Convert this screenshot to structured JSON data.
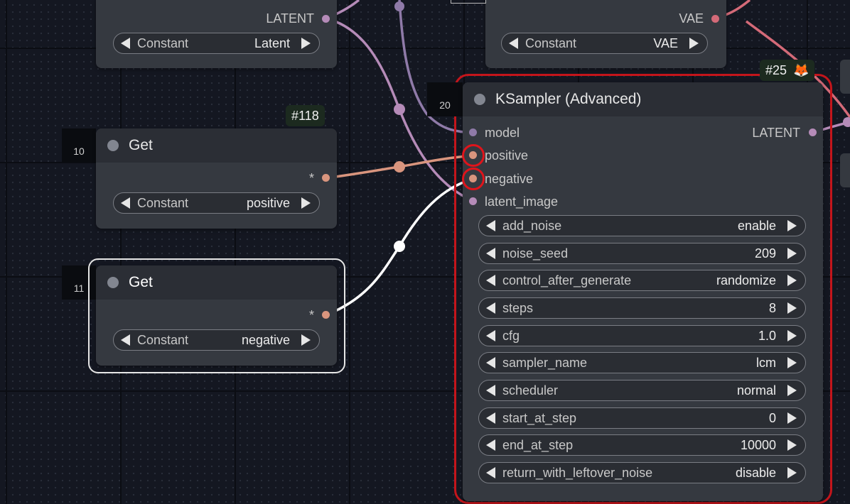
{
  "nodes": {
    "latent_const": {
      "output_label": "LATENT",
      "widget": {
        "name": "Constant",
        "value": "Latent"
      }
    },
    "vae_const": {
      "output_label": "VAE",
      "widget": {
        "name": "Constant",
        "value": "VAE"
      }
    },
    "get_positive": {
      "id": "10",
      "badge": "#118",
      "title": "Get",
      "output_label": "*",
      "widget": {
        "name": "Constant",
        "value": "positive"
      }
    },
    "get_negative": {
      "id": "11",
      "title": "Get",
      "output_label": "*",
      "widget": {
        "name": "Constant",
        "value": "negative"
      }
    },
    "ksampler": {
      "id": "20",
      "badge": "#25",
      "badge_icon": "fox-emoji",
      "badge_emoji": "🦊",
      "title": "KSampler (Advanced)",
      "inputs": [
        "model",
        "positive",
        "negative",
        "latent_image"
      ],
      "output_label": "LATENT",
      "widgets": [
        {
          "name": "add_noise",
          "value": "enable"
        },
        {
          "name": "noise_seed",
          "value": "209"
        },
        {
          "name": "control_after_generate",
          "value": "randomize"
        },
        {
          "name": "steps",
          "value": "8"
        },
        {
          "name": "cfg",
          "value": "1.0"
        },
        {
          "name": "sampler_name",
          "value": "lcm"
        },
        {
          "name": "scheduler",
          "value": "normal"
        },
        {
          "name": "start_at_step",
          "value": "0"
        },
        {
          "name": "end_at_step",
          "value": "10000"
        },
        {
          "name": "return_with_leftover_noise",
          "value": "disable"
        }
      ]
    }
  },
  "colors": {
    "canvas_bg": "#141721",
    "node_body": "#353940",
    "node_header": "#2b2e35",
    "model_link": "#8f7aa8",
    "latent_link": "#b58bb8",
    "conditioning_link": "#d9957e",
    "vae_link": "#d46a78",
    "selected_link": "#ffffff",
    "error_outline": "#c4151b"
  }
}
